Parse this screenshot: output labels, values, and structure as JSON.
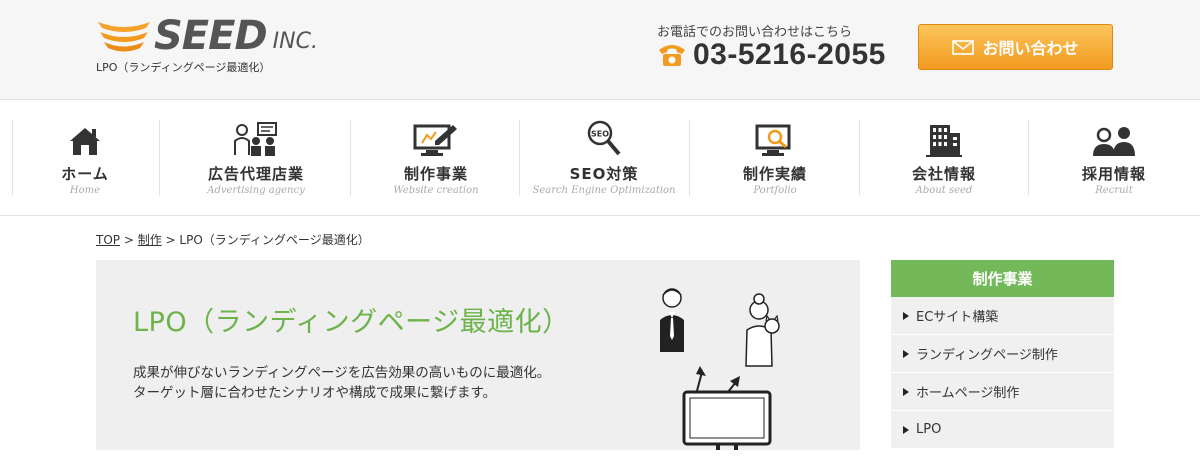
{
  "brand": {
    "name": "SEED",
    "suffix": "INC.",
    "tagline": "LPO（ランディングページ最適化）",
    "colors": {
      "logo_orange": "#f29a1e",
      "accent_green": "#6cb34a",
      "button_orange": "#f5a22a"
    }
  },
  "contact": {
    "caption": "お電話でのお問い合わせはこちら",
    "phone_icon": "telephone-icon",
    "phone": "03-5216-2055",
    "button_icon": "envelope-icon",
    "button_label": "お問い合わせ"
  },
  "nav": [
    {
      "icon": "house-icon",
      "jp": "ホーム",
      "en": "Home"
    },
    {
      "icon": "meeting-people-icon",
      "jp": "広告代理店業",
      "en": "Advertising agency"
    },
    {
      "icon": "monitor-pen-icon",
      "jp": "制作事業",
      "en": "Website creation"
    },
    {
      "icon": "seo-magnifier-icon",
      "jp": "SEO対策",
      "en": "Search Engine Optimization"
    },
    {
      "icon": "monitor-search-icon",
      "jp": "制作実績",
      "en": "Portfolio"
    },
    {
      "icon": "building-icon",
      "jp": "会社情報",
      "en": "About seed"
    },
    {
      "icon": "people-icon",
      "jp": "採用情報",
      "en": "Recruit"
    }
  ],
  "breadcrumb": {
    "top": "TOP",
    "sep1": " > ",
    "parent": "制作",
    "sep2": " > ",
    "current": "LPO（ランディングページ最適化）"
  },
  "hero": {
    "title": "LPO（ランディングページ最適化）",
    "desc_line1": "成果が伸びないランディングページを広告効果の高いものに最適化。",
    "desc_line2": "ターゲット層に合わせたシナリオや構成で成果に繋げます。",
    "illustration": "monitor-with-users-illustration"
  },
  "sidebar": {
    "heading": "制作事業",
    "items": [
      "ECサイト構築",
      "ランディングページ制作",
      "ホームページ制作",
      "LPO"
    ]
  }
}
